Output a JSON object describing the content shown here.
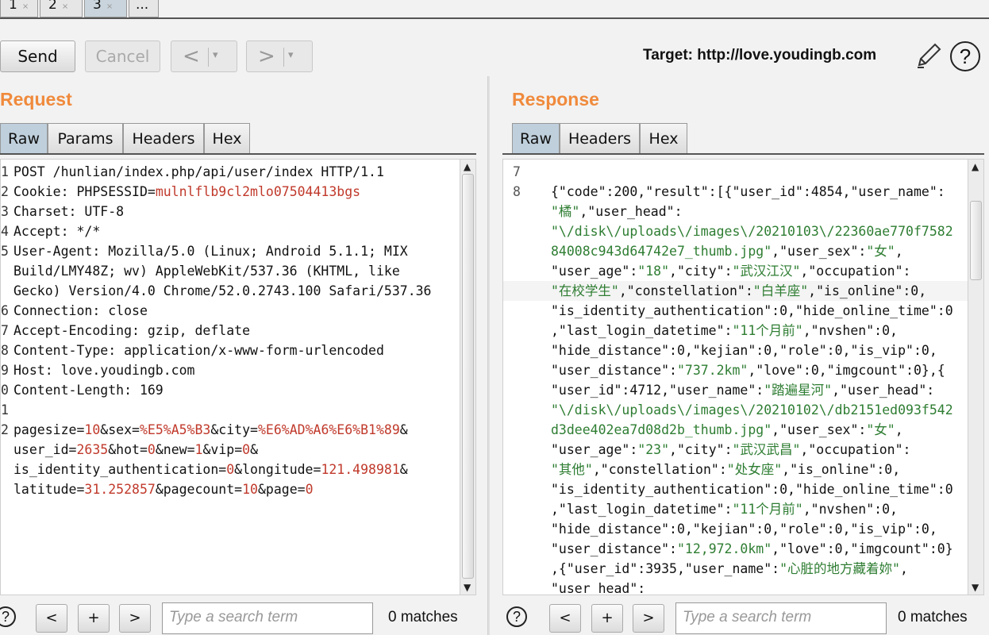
{
  "top_tabs": [
    {
      "label": "1",
      "close": "×"
    },
    {
      "label": "2",
      "close": "×"
    },
    {
      "label": "3",
      "close": "×"
    },
    {
      "label": "..."
    }
  ],
  "toolbar": {
    "send_label": "Send",
    "cancel_label": "Cancel",
    "back_glyph": "<",
    "forward_glyph": ">",
    "dropdown_glyph": "▾",
    "target_text": "Target: http://love.youdingb.com",
    "help_glyph": "?"
  },
  "request": {
    "title": "Request",
    "tabs": [
      "Raw",
      "Params",
      "Headers",
      "Hex"
    ],
    "lines": [
      {
        "n": "1",
        "parts": [
          {
            "t": "POST /hunlian/index.php/api/user/index HTTP/1.1"
          }
        ]
      },
      {
        "n": "2",
        "parts": [
          {
            "t": "Cookie: PHPSESSID="
          },
          {
            "t": "mulnlflb9cl2mlo07504413bgs",
            "c": "red"
          }
        ]
      },
      {
        "n": "3",
        "parts": [
          {
            "t": "Charset: UTF-8"
          }
        ]
      },
      {
        "n": "4",
        "parts": [
          {
            "t": "Accept: */*"
          }
        ]
      },
      {
        "n": "5",
        "parts": [
          {
            "t": "User-Agent: Mozilla/5.0 (Linux; Android 5.1.1; MIX"
          }
        ]
      },
      {
        "n": "",
        "parts": [
          {
            "t": "Build/LMY48Z; wv) AppleWebKit/537.36 (KHTML, like"
          }
        ]
      },
      {
        "n": "",
        "parts": [
          {
            "t": "Gecko) Version/4.0 Chrome/52.0.2743.100 Safari/537.36"
          }
        ]
      },
      {
        "n": "6",
        "parts": [
          {
            "t": "Connection: close"
          }
        ]
      },
      {
        "n": "7",
        "parts": [
          {
            "t": "Accept-Encoding: gzip, deflate"
          }
        ]
      },
      {
        "n": "8",
        "parts": [
          {
            "t": "Content-Type: application/x-www-form-urlencoded"
          }
        ]
      },
      {
        "n": "9",
        "parts": [
          {
            "t": "Host: love.youdingb.com"
          }
        ]
      },
      {
        "n": "0",
        "parts": [
          {
            "t": "Content-Length: 169"
          }
        ]
      },
      {
        "n": "1",
        "parts": [
          {
            "t": ""
          }
        ]
      },
      {
        "n": "2",
        "parts": [
          {
            "t": "pagesize="
          },
          {
            "t": "10",
            "c": "red"
          },
          {
            "t": "&sex="
          },
          {
            "t": "%E5%A5%B3",
            "c": "red"
          },
          {
            "t": "&city="
          },
          {
            "t": "%E6%AD%A6%E6%B1%89",
            "c": "red"
          },
          {
            "t": "&"
          }
        ]
      },
      {
        "n": "",
        "parts": [
          {
            "t": "user_id="
          },
          {
            "t": "2635",
            "c": "red"
          },
          {
            "t": "&hot="
          },
          {
            "t": "0",
            "c": "red"
          },
          {
            "t": "&new="
          },
          {
            "t": "1",
            "c": "red"
          },
          {
            "t": "&vip="
          },
          {
            "t": "0",
            "c": "red"
          },
          {
            "t": "&"
          }
        ]
      },
      {
        "n": "",
        "parts": [
          {
            "t": "is_identity_authentication="
          },
          {
            "t": "0",
            "c": "red"
          },
          {
            "t": "&longitude="
          },
          {
            "t": "121.498981",
            "c": "red"
          },
          {
            "t": "&"
          }
        ]
      },
      {
        "n": "",
        "parts": [
          {
            "t": "latitude="
          },
          {
            "t": "31.252857",
            "c": "red"
          },
          {
            "t": "&pagecount="
          },
          {
            "t": "10",
            "c": "red"
          },
          {
            "t": "&page="
          },
          {
            "t": "0",
            "c": "red"
          }
        ]
      }
    ]
  },
  "response": {
    "title": "Response",
    "tabs": [
      "Raw",
      "Headers",
      "Hex"
    ],
    "lines": [
      {
        "n": "7",
        "parts": [
          {
            "t": ""
          }
        ]
      },
      {
        "n": "8",
        "parts": [
          {
            "t": "{\"code\":200,\"result\":[{\"user_id\":4854,\"user_name\":"
          }
        ]
      },
      {
        "n": "",
        "parts": [
          {
            "t": "\"橘\"",
            "c": "grn"
          },
          {
            "t": ",\"user_head\":"
          }
        ]
      },
      {
        "n": "",
        "parts": [
          {
            "t": "\"\\/disk\\/uploads\\/images\\/20210103\\/22360ae770f7582",
            "c": "grn"
          }
        ]
      },
      {
        "n": "",
        "parts": [
          {
            "t": "84008c943d64742e7_thumb.jpg\"",
            "c": "grn"
          },
          {
            "t": ",\"user_sex\":"
          },
          {
            "t": "\"女\"",
            "c": "grn"
          },
          {
            "t": ","
          }
        ]
      },
      {
        "n": "",
        "parts": [
          {
            "t": "\"user_age\":"
          },
          {
            "t": "\"18\"",
            "c": "grn"
          },
          {
            "t": ",\"city\":"
          },
          {
            "t": "\"武汉江汉\"",
            "c": "grn"
          },
          {
            "t": ",\"occupation\":"
          }
        ]
      },
      {
        "n": "",
        "hl": true,
        "parts": [
          {
            "t": "\"在校学生\"",
            "c": "grn"
          },
          {
            "t": ",\"constellation\":"
          },
          {
            "t": "\"白羊座\"",
            "c": "grn"
          },
          {
            "t": ",\"is_online\":0,"
          }
        ]
      },
      {
        "n": "",
        "parts": [
          {
            "t": "\"is_identity_authentication\":0,\"hide_online_time\":0"
          }
        ]
      },
      {
        "n": "",
        "parts": [
          {
            "t": ",\"last_login_datetime\":"
          },
          {
            "t": "\"11个月前\"",
            "c": "grn"
          },
          {
            "t": ",\"nvshen\":0,"
          }
        ]
      },
      {
        "n": "",
        "parts": [
          {
            "t": "\"hide_distance\":0,\"kejian\":0,\"role\":0,\"is_vip\":0,"
          }
        ]
      },
      {
        "n": "",
        "parts": [
          {
            "t": "\"user_distance\":"
          },
          {
            "t": "\"737.2km\"",
            "c": "grn"
          },
          {
            "t": ",\"love\":0,\"imgcount\":0},{"
          }
        ]
      },
      {
        "n": "",
        "parts": [
          {
            "t": "\"user_id\":4712,\"user_name\":"
          },
          {
            "t": "\"踏遍星河\"",
            "c": "grn"
          },
          {
            "t": ",\"user_head\":"
          }
        ]
      },
      {
        "n": "",
        "parts": [
          {
            "t": "\"\\/disk\\/uploads\\/images\\/20210102\\/db2151ed093f542",
            "c": "grn"
          }
        ]
      },
      {
        "n": "",
        "parts": [
          {
            "t": "d3dee402ea7d08d2b_thumb.jpg\"",
            "c": "grn"
          },
          {
            "t": ",\"user_sex\":"
          },
          {
            "t": "\"女\"",
            "c": "grn"
          },
          {
            "t": ","
          }
        ]
      },
      {
        "n": "",
        "parts": [
          {
            "t": "\"user_age\":"
          },
          {
            "t": "\"23\"",
            "c": "grn"
          },
          {
            "t": ",\"city\":"
          },
          {
            "t": "\"武汉武昌\"",
            "c": "grn"
          },
          {
            "t": ",\"occupation\":"
          }
        ]
      },
      {
        "n": "",
        "parts": [
          {
            "t": "\"其他\"",
            "c": "grn"
          },
          {
            "t": ",\"constellation\":"
          },
          {
            "t": "\"处女座\"",
            "c": "grn"
          },
          {
            "t": ",\"is_online\":0,"
          }
        ]
      },
      {
        "n": "",
        "parts": [
          {
            "t": "\"is_identity_authentication\":0,\"hide_online_time\":0"
          }
        ]
      },
      {
        "n": "",
        "parts": [
          {
            "t": ",\"last_login_datetime\":"
          },
          {
            "t": "\"11个月前\"",
            "c": "grn"
          },
          {
            "t": ",\"nvshen\":0,"
          }
        ]
      },
      {
        "n": "",
        "parts": [
          {
            "t": "\"hide_distance\":0,\"kejian\":0,\"role\":0,\"is_vip\":0,"
          }
        ]
      },
      {
        "n": "",
        "parts": [
          {
            "t": "\"user_distance\":"
          },
          {
            "t": "\"12,972.0km\"",
            "c": "grn"
          },
          {
            "t": ",\"love\":0,\"imgcount\":0}"
          }
        ]
      },
      {
        "n": "",
        "parts": [
          {
            "t": ",{\"user_id\":3935,\"user_name\":"
          },
          {
            "t": "\"心脏的地方藏着妳\"",
            "c": "grn"
          },
          {
            "t": ","
          }
        ]
      },
      {
        "n": "",
        "parts": [
          {
            "t": "\"user_head\":"
          }
        ]
      }
    ]
  },
  "search": {
    "help_glyph": "?",
    "prev_glyph": "<",
    "add_glyph": "+",
    "next_glyph": ">",
    "placeholder": "Type a search term",
    "request_matches": "0 matches",
    "response_matches": "0 matches"
  },
  "colors": {
    "accent": "#f08a3c",
    "string": "#2e7d32",
    "param": "#c0392b"
  }
}
